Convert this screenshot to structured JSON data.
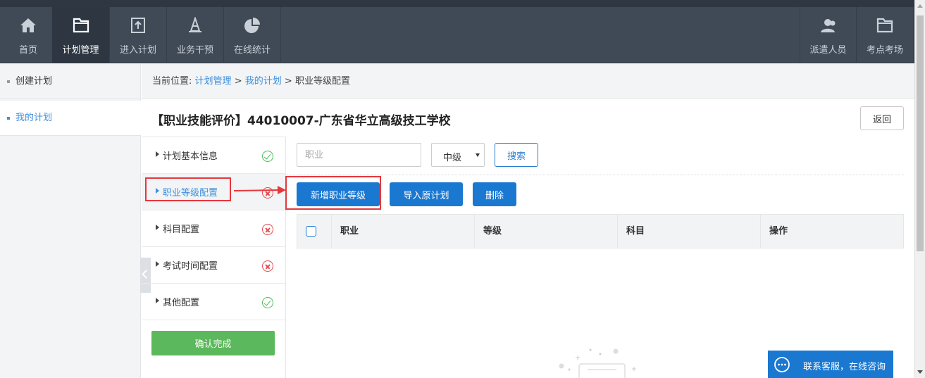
{
  "nav": {
    "items": [
      {
        "label": "首页",
        "icon": "home-icon"
      },
      {
        "label": "计划管理",
        "icon": "folder-icon"
      },
      {
        "label": "进入计划",
        "icon": "enter-plan-icon"
      },
      {
        "label": "业务干预",
        "icon": "cone-icon"
      },
      {
        "label": "在线统计",
        "icon": "pie-chart-icon"
      }
    ],
    "right_items": [
      {
        "label": "派遣人员",
        "icon": "people-icon"
      },
      {
        "label": "考点考场",
        "icon": "folder-icon"
      }
    ],
    "active": "计划管理"
  },
  "sidebar": {
    "items": [
      {
        "label": "创建计划"
      },
      {
        "label": "我的计划"
      }
    ],
    "active": "我的计划"
  },
  "breadcrumb": {
    "prefix": "当前位置:",
    "link1": "计划管理",
    "sep": ">",
    "link2": "我的计划",
    "current": "职业等级配置"
  },
  "page": {
    "title": "【职业技能评价】44010007-广东省华立高级技工学校",
    "back_label": "返回"
  },
  "steps": {
    "items": [
      {
        "label": "计划基本信息",
        "status": "complete"
      },
      {
        "label": "职业等级配置",
        "status": "incomplete"
      },
      {
        "label": "科目配置",
        "status": "incomplete"
      },
      {
        "label": "考试时间配置",
        "status": "incomplete"
      },
      {
        "label": "其他配置",
        "status": "complete"
      }
    ],
    "current": "职业等级配置",
    "confirm_label": "确认完成"
  },
  "filters": {
    "occupation_placeholder": "职业",
    "level_value": "中级",
    "search_label": "搜索"
  },
  "actions": {
    "add_label": "新增职业等级",
    "import_label": "导入原计划",
    "delete_label": "删除"
  },
  "table": {
    "columns": [
      "职业",
      "等级",
      "科目",
      "操作"
    ],
    "rows": []
  },
  "service": {
    "label": "联系客服，在线咨询"
  },
  "colors": {
    "nav_bg": "#3f4a56",
    "primary": "#1a78d1",
    "link": "#3d8fdc",
    "success": "#5cb85c",
    "error": "#e5484d",
    "annotation": "#e5383d"
  }
}
